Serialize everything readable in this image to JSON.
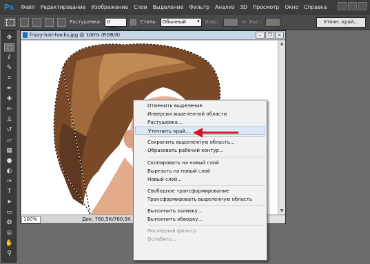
{
  "app": {
    "logo": "Ps"
  },
  "menu": [
    "Файл",
    "Редактирование",
    "Изображение",
    "Слои",
    "Выделение",
    "Фильтр",
    "Анализ",
    "3D",
    "Просмотр",
    "Окно",
    "Справка"
  ],
  "options": {
    "feather_label": "Растушевка:",
    "feather_value": "0 пикс.",
    "style_label": "Стиль:",
    "style_value": "Обычный",
    "width_label": "Шир.:",
    "height_label": "Выс.:",
    "refine_button": "Уточн. край..."
  },
  "document": {
    "title": "frizzy-hair-hacks.jpg @ 100% (RGB/8)",
    "zoom": "100%",
    "info": "Док: 760,5К/760,5К"
  },
  "context_menu": {
    "items": [
      {
        "label": "Отменить выделение",
        "state": "normal"
      },
      {
        "label": "Инверсия выделенной области",
        "state": "normal"
      },
      {
        "label": "Растушевка...",
        "state": "normal"
      },
      {
        "label": "Уточнить край...",
        "state": "hover"
      },
      {
        "label": "Сохранить выделенную область...",
        "state": "normal"
      },
      {
        "label": "Образовать рабочий контур...",
        "state": "normal"
      },
      {
        "label": "Скопировать на новый слой",
        "state": "normal"
      },
      {
        "label": "Вырезать на новый слой",
        "state": "normal"
      },
      {
        "label": "Новый слой...",
        "state": "normal"
      },
      {
        "label": "Свободное трансформирование",
        "state": "normal"
      },
      {
        "label": "Трансформировать выделенную область",
        "state": "normal"
      },
      {
        "label": "Выполнить заливку...",
        "state": "normal"
      },
      {
        "label": "Выполнить обводку...",
        "state": "normal"
      },
      {
        "label": "Последний фильтр",
        "state": "disabled"
      },
      {
        "label": "Ослабить...",
        "state": "disabled"
      }
    ]
  },
  "colors": {
    "arrow": "#d8141c",
    "hover": "#dde8f6"
  }
}
